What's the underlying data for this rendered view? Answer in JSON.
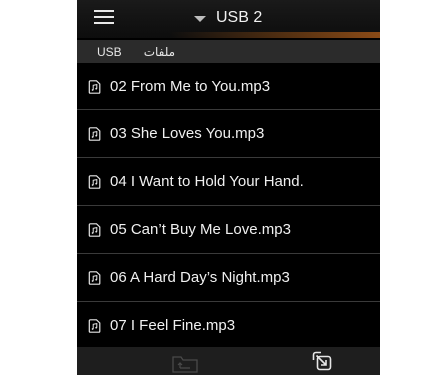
{
  "header": {
    "menu_icon": "hamburger-menu-icon",
    "dropdown_icon": "chevron-down-icon",
    "source_title": "USB 2"
  },
  "breadcrumb": {
    "root": "USB",
    "files_label": "ملفات"
  },
  "files": [
    {
      "name": "02 From Me to You.mp3",
      "icon": "music-file-icon"
    },
    {
      "name": "03 She Loves You.mp3",
      "icon": "music-file-icon"
    },
    {
      "name": "04 I Want to Hold Your Hand.",
      "icon": "music-file-icon"
    },
    {
      "name": "05 Can’t Buy Me Love.mp3",
      "icon": "music-file-icon"
    },
    {
      "name": "06 A Hard Day’s Night.mp3",
      "icon": "music-file-icon"
    },
    {
      "name": "07 I Feel Fine.mp3",
      "icon": "music-file-icon"
    }
  ],
  "bottom_bar": {
    "folder_up_icon": "folder-up-icon",
    "exit_icon": "exit-arrow-icon"
  },
  "colors": {
    "background": "#000000",
    "text": "#f0f0f0",
    "accent_glow": "#a85a19",
    "divider": "#3a3a3a"
  }
}
